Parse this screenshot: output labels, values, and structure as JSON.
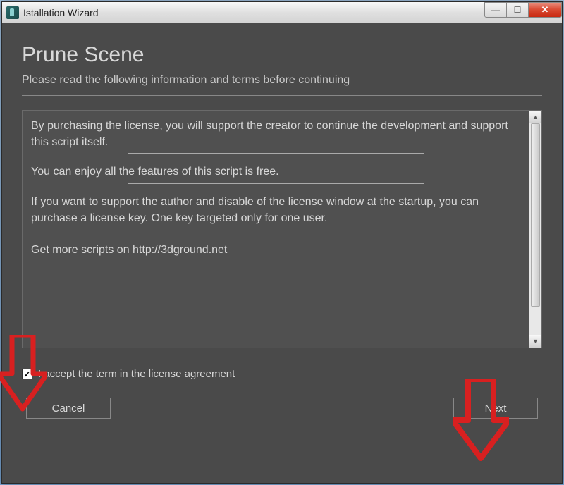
{
  "titlebar": {
    "title": "Istallation Wizard"
  },
  "window_controls": {
    "minimize": "—",
    "maximize": "☐",
    "close": "✕"
  },
  "header": {
    "heading": "Prune Scene",
    "subheading": "Please read the following information and terms before continuing"
  },
  "license_text": {
    "p1": "By purchasing the license, you will support the creator  to continue the development and support this script itself.",
    "p2": "You can enjoy all the features of this script is free.",
    "p3": "If you want to support the author and disable of the license window at the startup, you can purchase a license key. One key targeted only for one user.",
    "p4": "Get more scripts on http://3dground.net"
  },
  "checkbox": {
    "checked": true,
    "label": "I accept the term in the license agreement"
  },
  "buttons": {
    "cancel": "Cancel",
    "next": "Next"
  },
  "scrollbar": {
    "up": "▲",
    "down": "▼"
  }
}
